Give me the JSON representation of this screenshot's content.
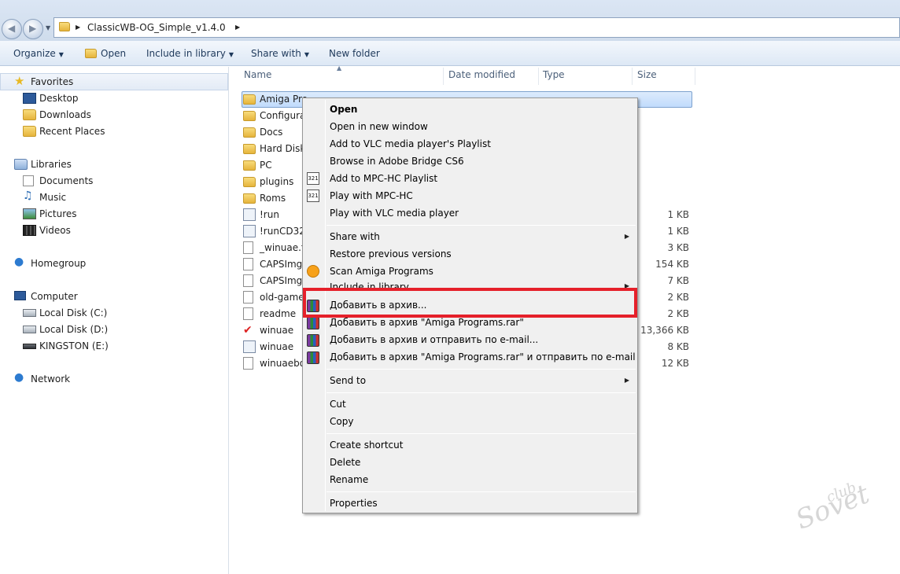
{
  "address": {
    "path": "ClassicWB-OG_Simple_v1.4.0"
  },
  "toolbar": {
    "organize": "Organize",
    "open": "Open",
    "include": "Include in library",
    "share": "Share with",
    "newfolder": "New folder"
  },
  "nav": {
    "favorites": "Favorites",
    "desktop": "Desktop",
    "downloads": "Downloads",
    "recent": "Recent Places",
    "libraries": "Libraries",
    "documents": "Documents",
    "music": "Music",
    "pictures": "Pictures",
    "videos": "Videos",
    "homegroup": "Homegroup",
    "computer": "Computer",
    "diskc": "Local Disk (C:)",
    "diskd": "Local Disk (D:)",
    "kingston": "KINGSTON (E:)",
    "network": "Network"
  },
  "columns": {
    "name": "Name",
    "date": "Date modified",
    "type": "Type",
    "size": "Size"
  },
  "files": [
    {
      "name": "Amiga Pro",
      "size": ""
    },
    {
      "name": "Configurat",
      "size": ""
    },
    {
      "name": "Docs",
      "size": ""
    },
    {
      "name": "Hard Disk",
      "size": ""
    },
    {
      "name": "PC",
      "size": ""
    },
    {
      "name": "plugins",
      "size": ""
    },
    {
      "name": "Roms",
      "size": ""
    },
    {
      "name": "!run",
      "size": "1 KB"
    },
    {
      "name": "!runCD32",
      "size": "1 KB"
    },
    {
      "name": "_winuae.fx",
      "size": "3 KB"
    },
    {
      "name": "CAPSImg.",
      "size": "154 KB"
    },
    {
      "name": "CAPSImg.",
      "size": "7 KB"
    },
    {
      "name": "old-game",
      "size": "2 KB"
    },
    {
      "name": "readme",
      "size": "2 KB"
    },
    {
      "name": "winuae",
      "size": "13,366 KB"
    },
    {
      "name": "winuae",
      "size": "8 KB"
    },
    {
      "name": "winuaebo",
      "size": "12 KB"
    }
  ],
  "menu": {
    "open": "Open",
    "open_new": "Open in new window",
    "vlc_playlist": "Add to VLC media player's Playlist",
    "bridge": "Browse in Adobe Bridge CS6",
    "mpc_playlist": "Add to MPC-HC Playlist",
    "mpc_play": "Play with MPC-HC",
    "vlc_play": "Play with VLC media player",
    "share": "Share with",
    "restore": "Restore previous versions",
    "scan": "Scan Amiga Programs",
    "include": "Include in library",
    "rar_add": "Добавить в архив...",
    "rar_add_named": "Добавить в архив \"Amiga Programs.rar\"",
    "rar_email": "Добавить в архив и отправить по e-mail...",
    "rar_named_email": "Добавить в архив \"Amiga Programs.rar\" и отправить по e-mail",
    "sendto": "Send to",
    "cut": "Cut",
    "copy": "Copy",
    "shortcut": "Create shortcut",
    "delete": "Delete",
    "rename": "Rename",
    "properties": "Properties"
  },
  "watermark": {
    "line1": "Sovet",
    "line2": "club"
  }
}
